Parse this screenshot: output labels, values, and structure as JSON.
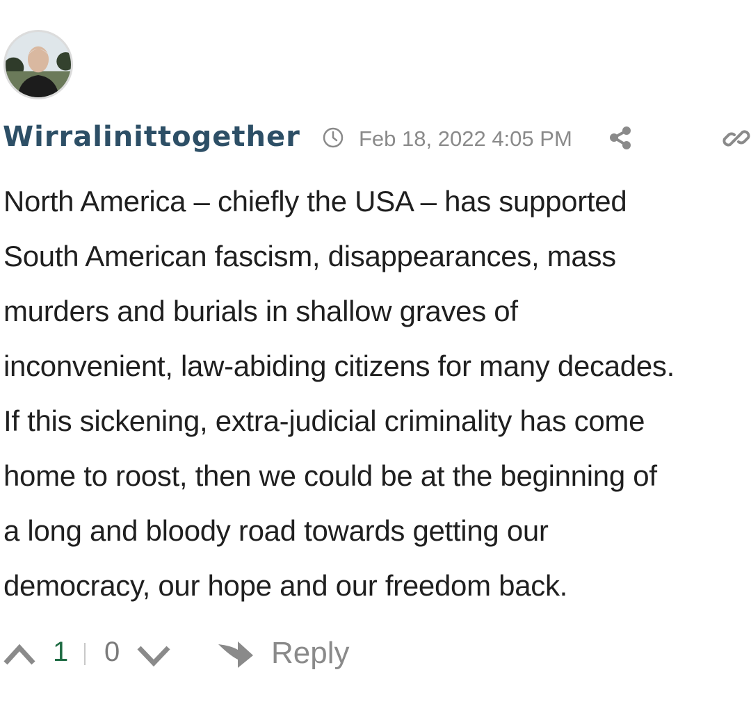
{
  "comment": {
    "author": "Wirralinittogether",
    "timestamp": "Feb 18, 2022 4:05 PM",
    "body_lines": [
      "North America – chiefly the USA – has supported",
      "South American fascism, disappearances, mass",
      "murders and burials in shallow graves of",
      "inconvenient, law-abiding citizens for many decades.",
      "If this sickening, extra-judicial criminality has come",
      "home to roost, then we could be at the beginning of",
      "a long and bloody road towards getting our",
      "democracy, our hope and our freedom back."
    ]
  },
  "votes": {
    "upvotes": "1",
    "downvotes": "0"
  },
  "actions": {
    "reply_label": "Reply"
  },
  "colors": {
    "author": "#2d4f66",
    "muted": "#8a8a8a",
    "upvote_count": "#1e6b43"
  },
  "icons": [
    "clock-icon",
    "share-icon",
    "link-icon",
    "upvote-icon",
    "downvote-icon",
    "reply-arrow-icon"
  ]
}
